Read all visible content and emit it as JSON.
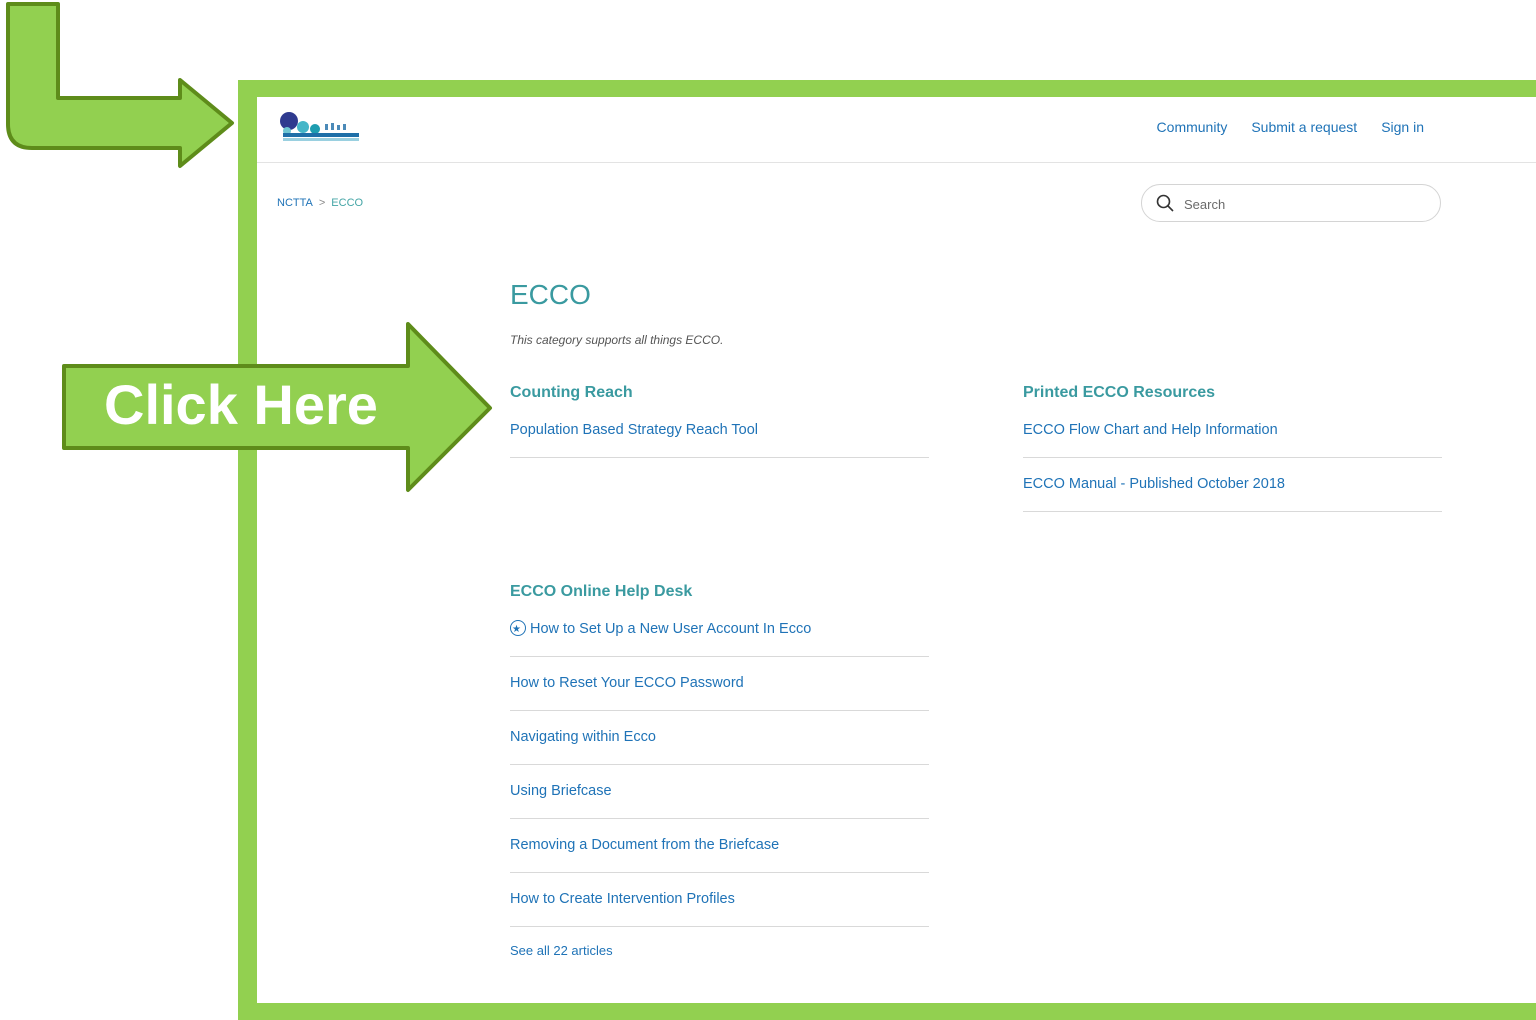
{
  "header": {
    "nav": [
      "Community",
      "Submit a request",
      "Sign in"
    ]
  },
  "breadcrumb": {
    "root": "NCTTA",
    "separator": ">",
    "current": "ECCO"
  },
  "search": {
    "placeholder": "Search"
  },
  "category": {
    "title": "ECCO",
    "description": "This category supports all things ECCO."
  },
  "sections": {
    "counting_reach": {
      "title": "Counting Reach",
      "articles": [
        "Population Based Strategy Reach Tool"
      ]
    },
    "printed_resources": {
      "title": "Printed ECCO Resources",
      "articles": [
        "ECCO Flow Chart and Help Information",
        "ECCO Manual - Published October 2018"
      ]
    },
    "help_desk": {
      "title": "ECCO Online Help Desk",
      "articles": [
        "How to Set Up a New User Account In Ecco",
        "How to Reset Your ECCO Password",
        "Navigating within Ecco",
        "Using Briefcase",
        "Removing a Document from the Briefcase",
        "How to Create Intervention Profiles"
      ],
      "see_all": "See all 22 articles"
    }
  },
  "overlay": {
    "label": "Click Here",
    "color": "#92d050",
    "outline_color": "#5e8c1a"
  }
}
